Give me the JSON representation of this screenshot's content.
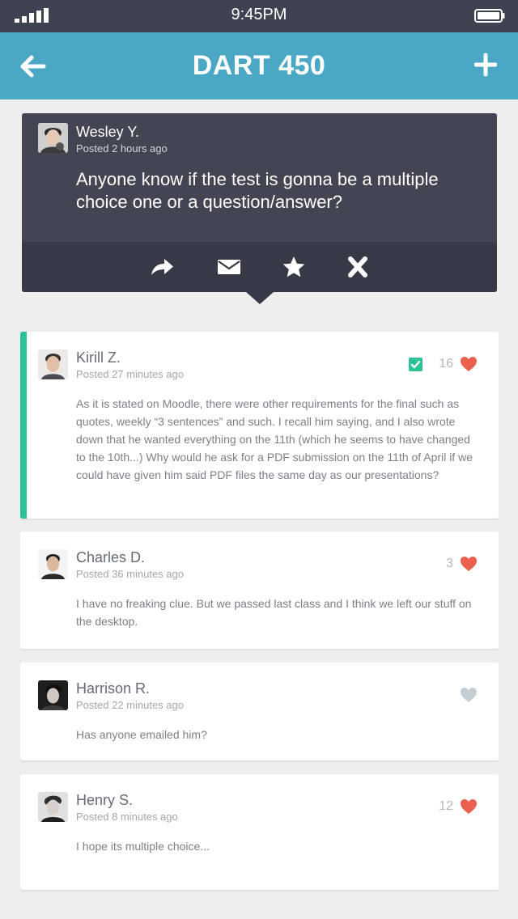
{
  "status_bar": {
    "time": "9:45PM"
  },
  "header": {
    "title": "DART 450"
  },
  "featured_post": {
    "author": "Wesley Y.",
    "posted": "Posted 2 hours ago",
    "text": "Anyone know if the test is gonna be a multiple choice one or a question/answer?",
    "actions": [
      "share-icon",
      "mail-icon",
      "star-icon",
      "close-icon"
    ]
  },
  "comments": [
    {
      "author": "Kirill Z.",
      "posted": "Posted 27 minutes ago",
      "likes": "16",
      "accepted": true,
      "text": "As it is stated on Moodle, there were other requirements for the final such as quotes, weekly “3 sentences” and such. I recall him saying, and I also wrote down that he wanted everything on the 11th (which he seems to have changed to the 10th...) Why would he ask for a PDF submission on the 11th of April if we could have given him said PDF files the same day as our presentations?"
    },
    {
      "author": "Charles D.",
      "posted": "Posted 36 minutes ago",
      "likes": "3",
      "text": "I have no freaking clue. But we passed last class and I think we left our stuff on the desktop."
    },
    {
      "author": "Harrison R.",
      "posted": "Posted 22 minutes ago",
      "likes": "",
      "text": "Has anyone emailed him?"
    },
    {
      "author": "Henry S.",
      "posted": "Posted 8 minutes ago",
      "likes": "12",
      "text": "I hope its multiple choice..."
    }
  ],
  "colors": {
    "header": "#4aa8c4",
    "featured_bg": "#434552",
    "accepted_accent": "#2ac296",
    "heart_active": "#e9604d",
    "heart_inactive": "#c5ced3"
  }
}
